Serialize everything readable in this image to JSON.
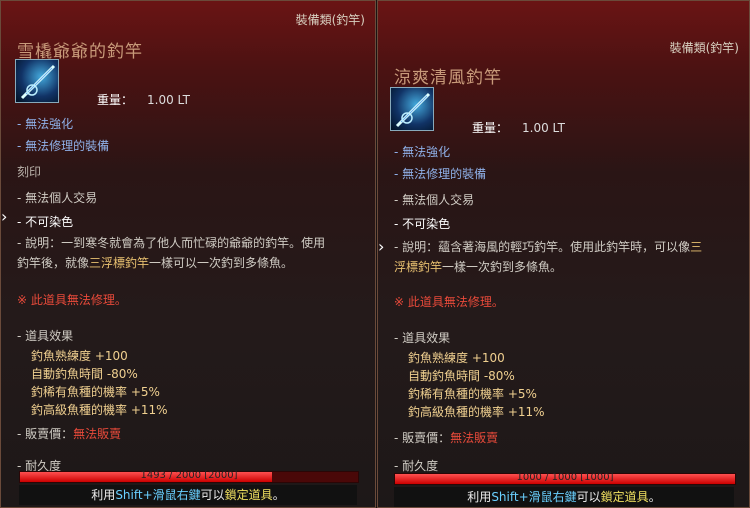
{
  "left": {
    "category": "裝備類(釣竿)",
    "title": "雪橇爺爺的釣竿",
    "icon": "fishing-rod-icon",
    "weight_label": "重量：",
    "weight_value": "1.00 LT",
    "flags": [
      "- 無法強化",
      "- 無法修理的裝備"
    ],
    "stamp_label": "刻印",
    "no_trade": "- 無法個人交易",
    "no_dye": "- 不可染色",
    "desc_prefix": "- 說明：一到寒冬就會為了他人而忙碌的爺爺的釣竿。使用",
    "desc_line2_a": "釣竿後，就像",
    "desc_line2_gold": "三浮標釣竿",
    "desc_line2_b": "一樣可以一次釣到多條魚。",
    "warning": "※ 此道具無法修理。",
    "effects_label": "- 道具效果",
    "effects": [
      "釣魚熟練度 +100",
      "自動釣魚時間 -80%",
      "釣稀有魚種的機率 +5%",
      "釣高級魚種的機率 +11%"
    ],
    "price_label": "- 販賣價：",
    "price_value": "無法販賣",
    "durability_label": "- 耐久度",
    "durability_text": "1493 / 2000 [2000]",
    "durability_fraction": 0.7465,
    "lock_a": "利用",
    "lock_b": "Shift+滑鼠右鍵",
    "lock_c": "可以",
    "lock_d": "鎖定道具",
    "lock_e": "。"
  },
  "right": {
    "category": "裝備類(釣竿)",
    "title": "涼爽清風釣竿",
    "icon": "fishing-rod-icon",
    "weight_label": "重量：",
    "weight_value": "1.00 LT",
    "flags": [
      "- 無法強化",
      "- 無法修理的裝備"
    ],
    "no_trade": "- 無法個人交易",
    "no_dye": "- 不可染色",
    "desc_prefix": "- 說明：蘊含著海風的輕巧釣竿。使用此釣竿時，可以像",
    "desc_prefix_gold": "三",
    "desc_line2_gold": "浮標釣竿",
    "desc_line2_b": "一樣一次釣到多條魚。",
    "warning": "※ 此道具無法修理。",
    "effects_label": "- 道具效果",
    "effects": [
      "釣魚熟練度 +100",
      "自動釣魚時間 -80%",
      "釣稀有魚種的機率 +5%",
      "釣高級魚種的機率 +11%"
    ],
    "price_label": "- 販賣價：",
    "price_value": "無法販賣",
    "durability_label": "- 耐久度",
    "durability_text": "1000 / 1000 [1000]",
    "durability_fraction": 1.0,
    "lock_a": "利用",
    "lock_b": "Shift+滑鼠右鍵",
    "lock_c": "可以",
    "lock_d": "鎖定道具",
    "lock_e": "。"
  },
  "colors": {
    "title": "#c89a7a",
    "flag_blue": "#8fb0e8",
    "warning": "#e84a3a",
    "effect": "#f0d090",
    "durability": "#e02020"
  }
}
